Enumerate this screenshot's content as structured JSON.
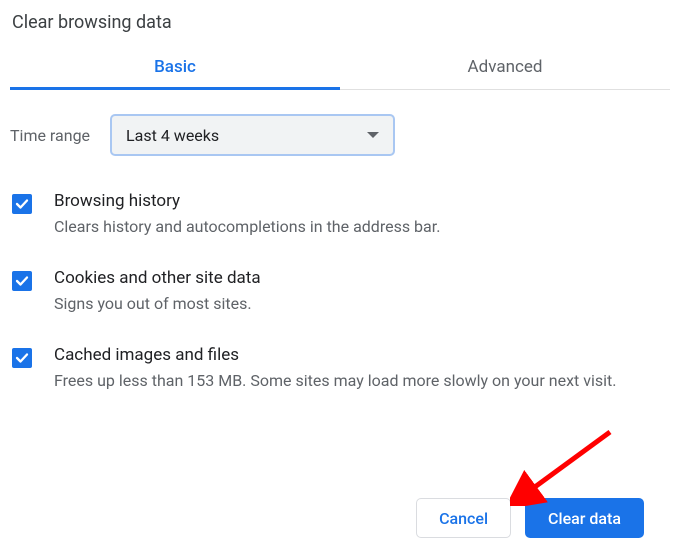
{
  "title": "Clear browsing data",
  "tabs": {
    "basic": "Basic",
    "advanced": "Advanced"
  },
  "timerange": {
    "label": "Time range",
    "selected": "Last 4 weeks"
  },
  "options": [
    {
      "title": "Browsing history",
      "desc": "Clears history and autocompletions in the address bar."
    },
    {
      "title": "Cookies and other site data",
      "desc": "Signs you out of most sites."
    },
    {
      "title": "Cached images and files",
      "desc": "Frees up less than 153 MB. Some sites may load more slowly on your next visit."
    }
  ],
  "buttons": {
    "cancel": "Cancel",
    "clear": "Clear data"
  }
}
